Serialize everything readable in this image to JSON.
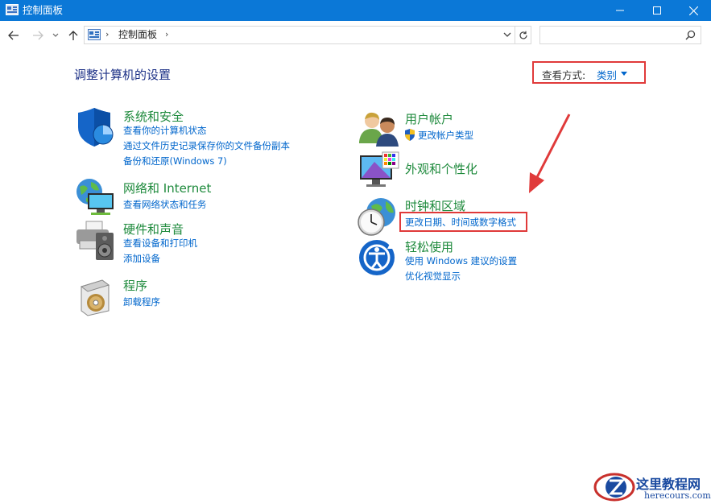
{
  "window": {
    "title": "控制面板",
    "titlebar_color": "#0b78d7"
  },
  "address_bar": {
    "crumb": "控制面板",
    "separator": "›",
    "search_placeholder": ""
  },
  "content": {
    "heading": "调整计算机的设置",
    "view_mode_label": "查看方式:",
    "view_mode_value": "类别"
  },
  "categories": [
    {
      "title": "系统和安全",
      "icon": "shield-icon",
      "links": [
        "查看你的计算机状态",
        "通过文件历史记录保存你的文件备份副本",
        "备份和还原(Windows 7)"
      ]
    },
    {
      "title": "网络和 Internet",
      "icon": "network-globe-icon",
      "links": [
        "查看网络状态和任务"
      ]
    },
    {
      "title": "硬件和声音",
      "icon": "printer-speaker-icon",
      "links": [
        "查看设备和打印机",
        "添加设备"
      ]
    },
    {
      "title": "程序",
      "icon": "programs-disc-icon",
      "links": [
        "卸载程序"
      ]
    },
    {
      "title": "用户帐户",
      "icon": "users-icon",
      "links": [
        "更改帐户类型"
      ]
    },
    {
      "title": "外观和个性化",
      "icon": "monitor-palette-icon",
      "links": []
    },
    {
      "title": "时钟和区域",
      "icon": "clock-globe-icon",
      "links": [
        "更改日期、时间或数字格式"
      ]
    },
    {
      "title": "轻松使用",
      "icon": "ease-of-access-icon",
      "links": [
        "使用 Windows 建议的设置",
        "优化视觉显示"
      ]
    }
  ],
  "watermark": {
    "name": "这里教程网",
    "url": "herecours.com"
  },
  "colors": {
    "category_title": "#1e8a3c",
    "link": "#0066cc",
    "heading": "#1e3287",
    "highlight": "#e03a3a"
  }
}
